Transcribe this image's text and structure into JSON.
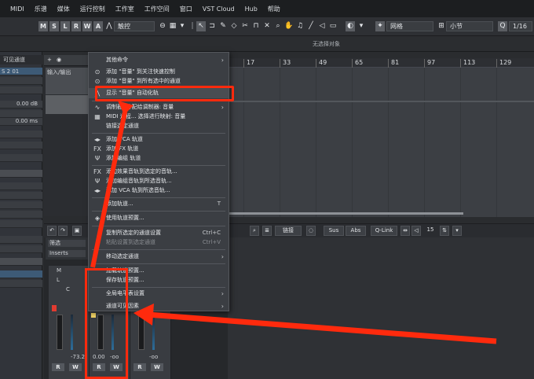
{
  "menubar": {
    "items": [
      "",
      "MIDI",
      "乐谱",
      "媒体",
      "运行控制",
      "工作室",
      "工作空间",
      "窗口",
      "VST Cloud",
      "Hub",
      "帮助"
    ]
  },
  "toolbar": {
    "buttons": [
      "M",
      "S",
      "L",
      "R",
      "W",
      "A"
    ],
    "touch_mode": "触控",
    "snap_grid": "网格",
    "grid_unit": "小节",
    "quantize": "1/16"
  },
  "infobar": {
    "status": "无选择对象"
  },
  "inspector": {
    "title": "可见通道",
    "track_label": "S 2 01",
    "volume": "0.00 dB",
    "delay": "0.00 ms",
    "inserts": "Inserts",
    "filter": "筛选"
  },
  "tracklist": {
    "folder_label": "输入/输出"
  },
  "ruler": {
    "bars": [
      "17",
      "33",
      "49",
      "65",
      "81",
      "97",
      "113",
      "129"
    ]
  },
  "lower_toolbar": {
    "link": "链接",
    "sus": "Sus",
    "abs": "Abs",
    "qlink": "Q-Link",
    "count": "15"
  },
  "mixer": {
    "channel1": {
      "value": "-73.2",
      "read": "R",
      "write": "W"
    },
    "channel2": {
      "value": "0.00",
      "read": "R",
      "write": "W"
    },
    "channel3": {
      "value": "-oo",
      "read": "R",
      "write": "W"
    },
    "channel4": {
      "value": "-oo",
      "read": "R",
      "write": "W"
    },
    "m_label": "M",
    "l_label": "L",
    "c_label": "C"
  },
  "context_menu": {
    "items": [
      {
        "label": "其他命令",
        "arrow": "›"
      },
      {
        "label": "添加 \"音量\" 到关注快速控制"
      },
      {
        "label": "添加 \"音量\" 到所有选中的通道"
      },
      {
        "label": "显示 \"音量\" 自动化轨"
      },
      {
        "label": "调制器:  分配给调制器:  音量",
        "arrow": "›"
      },
      {
        "label": "MIDI 远程...  选择进行映射:  音量"
      },
      {
        "label": "链接选定通道"
      },
      {
        "label": "添加 VCA 轨道"
      },
      {
        "label": "添加 FX 轨道"
      },
      {
        "label": "添加编组 轨道"
      },
      {
        "label": "添加效果音轨到选定的音轨..."
      },
      {
        "label": "添加编组音轨到所选音轨..."
      },
      {
        "label": "添加 VCA 轨到所选音轨..."
      },
      {
        "label": "添加轨道...",
        "shortcut": "T"
      },
      {
        "label": "使用轨道预置..."
      },
      {
        "label": "复制所选定的通道设置",
        "shortcut": "Ctrl+C"
      },
      {
        "label": "粘贴设置到选定通道",
        "shortcut": "Ctrl+V"
      },
      {
        "label": "移动选定通道",
        "arrow": "›"
      },
      {
        "label": "加载轨道预置..."
      },
      {
        "label": "保存轨道预置..."
      },
      {
        "label": "全局电平表设置",
        "arrow": "›"
      },
      {
        "label": "通道可见因素",
        "arrow": "›"
      }
    ]
  },
  "colors": {
    "highlight": "#ff2a0d",
    "arrow": "#ff2a0d",
    "background": "#2a2c2f"
  }
}
